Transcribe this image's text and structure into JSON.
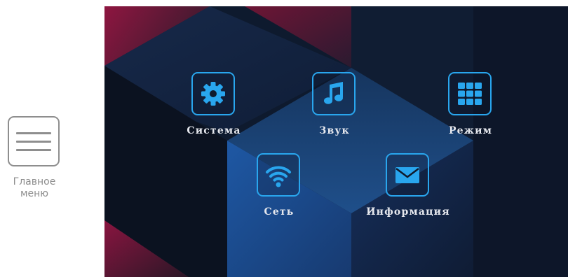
{
  "side_menu": {
    "icon": "hamburger-icon",
    "caption_line1": "Главное",
    "caption_line2": "меню"
  },
  "menu": {
    "items": [
      {
        "label": "Система",
        "icon": "gear-icon"
      },
      {
        "label": "Звук",
        "icon": "music-note-icon"
      },
      {
        "label": "Режим",
        "icon": "grid-icon"
      },
      {
        "label": "Сеть",
        "icon": "wifi-icon"
      },
      {
        "label": "Информация",
        "icon": "envelope-icon"
      }
    ]
  },
  "colors": {
    "accent": "#29a6ee",
    "label": "#e6e8ee",
    "background_navy": "#0f1a2c",
    "background_crimson": "#8e1640",
    "outside_text": "#8e8e8e"
  }
}
